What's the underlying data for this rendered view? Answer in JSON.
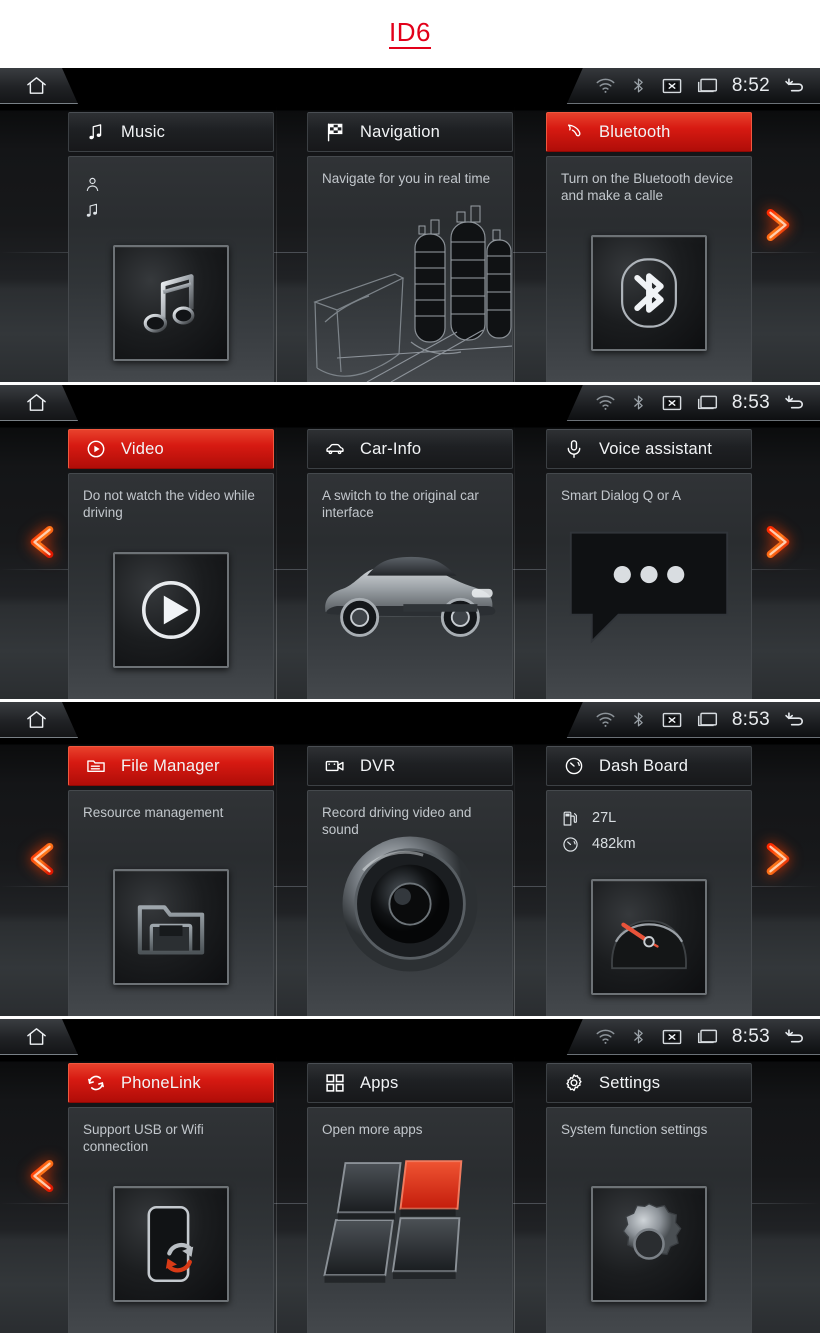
{
  "title": {
    "text": "ID6"
  },
  "colors": {
    "accent_red": "#d71a12",
    "title_red": "#e2001a",
    "arrow_orange": "#ff4b10",
    "card_bg": "#303336"
  },
  "status": {
    "icons": [
      "wifi-icon",
      "bluetooth-icon",
      "mute-box-icon",
      "display-icon",
      "back-arrow-icon"
    ],
    "home_label": "home-icon"
  },
  "panels": [
    {
      "id": "panel-1",
      "time": "8:52",
      "nav": {
        "left": false,
        "right": true
      },
      "cards": [
        {
          "name": "music",
          "title": "Music",
          "icon": "music-note-icon",
          "active": false,
          "desc": "",
          "rows": [
            {
              "icon": "person-icon",
              "text": ""
            },
            {
              "icon": "music-note-icon",
              "text": ""
            }
          ],
          "thumb": "music-note-thumb"
        },
        {
          "name": "navigation",
          "title": "Navigation",
          "icon": "checkered-flag-icon",
          "active": false,
          "desc": "Navigate for you in real time",
          "rows": [],
          "thumb": "city-illustration"
        },
        {
          "name": "bluetooth",
          "title": "Bluetooth",
          "icon": "phone-handset-icon",
          "active": true,
          "desc": "Turn on the Bluetooth device and make a calle",
          "rows": [],
          "thumb": "bluetooth-thumb"
        }
      ]
    },
    {
      "id": "panel-2",
      "time": "8:53",
      "nav": {
        "left": true,
        "right": true
      },
      "cards": [
        {
          "name": "video",
          "title": "Video",
          "icon": "play-circle-icon",
          "active": true,
          "desc": "Do not watch the video while driving",
          "rows": [],
          "thumb": "play-thumb"
        },
        {
          "name": "car-info",
          "title": "Car-Info",
          "icon": "car-icon",
          "active": false,
          "desc": "A switch to the original car interface",
          "rows": [],
          "thumb": "car-illustration"
        },
        {
          "name": "voice-assistant",
          "title": "Voice assistant",
          "icon": "microphone-icon",
          "active": false,
          "desc": "Smart Dialog Q or A",
          "rows": [],
          "thumb": "speech-bubble-illustration"
        }
      ]
    },
    {
      "id": "panel-3",
      "time": "8:53",
      "nav": {
        "left": true,
        "right": true
      },
      "cards": [
        {
          "name": "file-manager",
          "title": "File Manager",
          "icon": "folder-icon",
          "active": true,
          "desc": "Resource management",
          "rows": [],
          "thumb": "folder-thumb"
        },
        {
          "name": "dvr",
          "title": "DVR",
          "icon": "video-camera-icon",
          "active": false,
          "desc": "Record driving video and sound",
          "rows": [],
          "thumb": "lens-illustration"
        },
        {
          "name": "dash-board",
          "title": "Dash Board",
          "icon": "gauge-icon",
          "active": false,
          "desc": "",
          "rows": [
            {
              "icon": "fuel-pump-icon",
              "text": "27L"
            },
            {
              "icon": "gauge-icon",
              "text": "482km"
            }
          ],
          "thumb": "gauge-thumb"
        }
      ]
    },
    {
      "id": "panel-4",
      "time": "8:53",
      "nav": {
        "left": true,
        "right": false
      },
      "cards": [
        {
          "name": "phonelink",
          "title": "PhoneLink",
          "icon": "sync-icon",
          "active": true,
          "desc": "Support USB or Wifi connection",
          "rows": [],
          "thumb": "phonelink-thumb"
        },
        {
          "name": "apps",
          "title": "Apps",
          "icon": "grid-icon",
          "active": false,
          "desc": "Open more apps",
          "rows": [],
          "thumb": "tiles-illustration"
        },
        {
          "name": "settings",
          "title": "Settings",
          "icon": "gear-icon",
          "active": false,
          "desc": "System function settings",
          "rows": [],
          "thumb": "gear-thumb"
        }
      ]
    }
  ]
}
